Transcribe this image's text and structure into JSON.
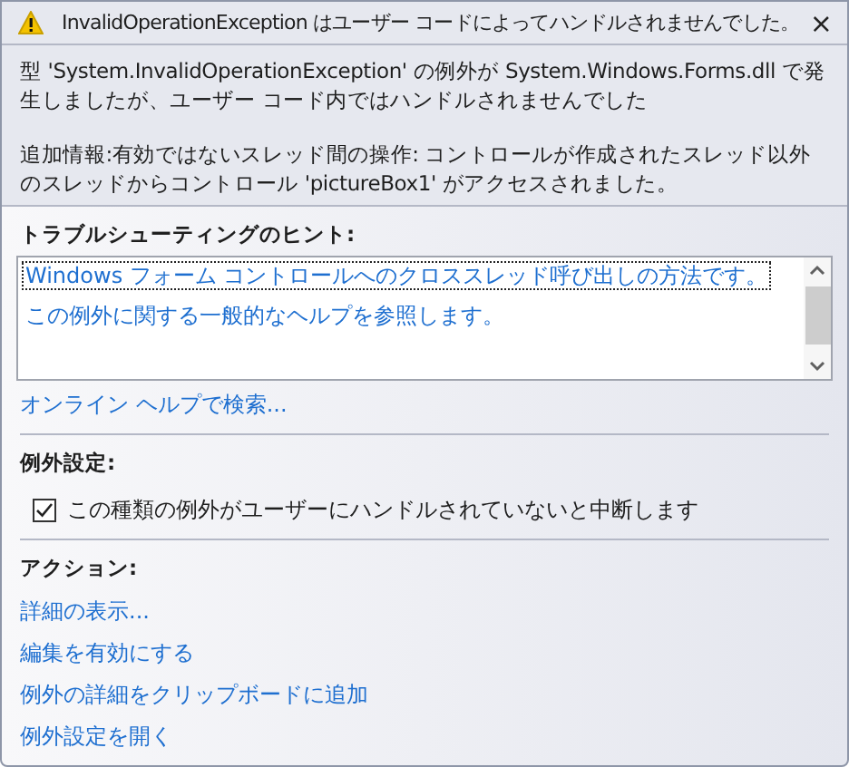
{
  "window": {
    "title": "InvalidOperationException はユーザー コードによってハンドルされませんでした。",
    "close": "×"
  },
  "message": [
    "型 'System.InvalidOperationException' の例外が System.Windows.Forms.dll で発生しましたが、ユーザー コード内ではハンドルされませんでした",
    "追加情報:有効ではないスレッド間の操作: コントロールが作成されたスレッド以外のスレッドからコントロール 'pictureBox1' がアクセスされました。"
  ],
  "troubleshooting": {
    "heading": "トラブルシューティングのヒント:",
    "tips": [
      {
        "text": "Windows フォーム コントロールへのクロススレッド呼び出しの方法です。",
        "selected": true
      },
      {
        "text": "この例外に関する一般的なヘルプを参照します。",
        "selected": false
      }
    ],
    "search_link": "オンライン ヘルプで検索..."
  },
  "exception_settings": {
    "heading": "例外設定:",
    "checkbox": {
      "label": "この種類の例外がユーザーにハンドルされていないと中断します",
      "checked": true
    }
  },
  "actions": {
    "heading": "アクション:",
    "links": [
      "詳細の表示...",
      "編集を有効にする",
      "例外の詳細をクリップボードに追加",
      "例外設定を開く"
    ]
  }
}
